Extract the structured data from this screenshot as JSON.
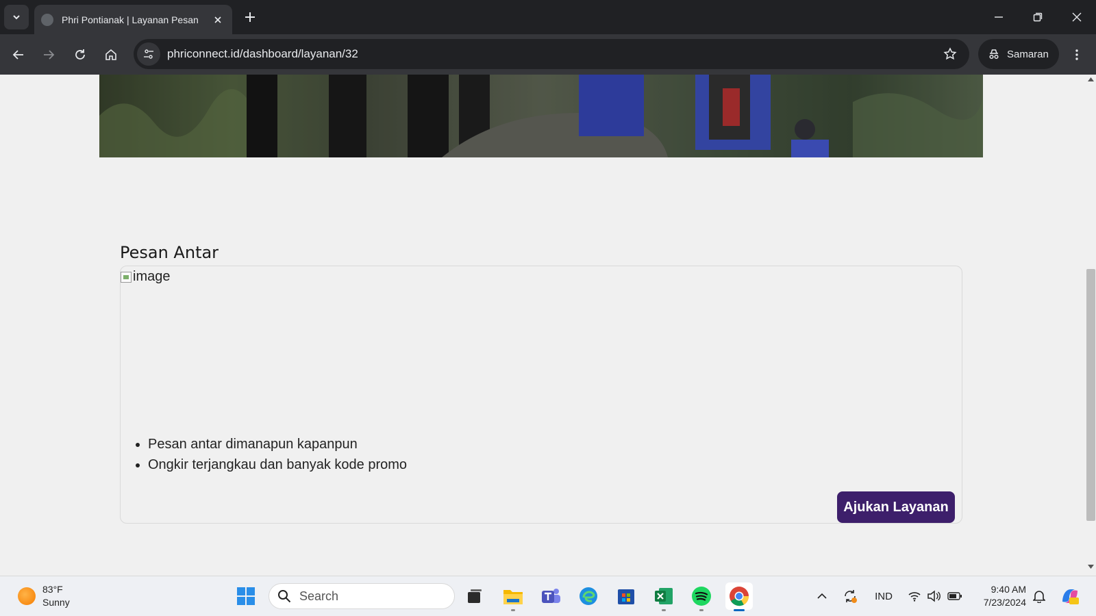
{
  "browser": {
    "tab_title": "Phri Pontianak | Layanan Pesan",
    "url": "phriconnect.id/dashboard/layanan/32",
    "profile_label": "Samaran"
  },
  "page": {
    "section_title": "Pesan Antar",
    "image_alt": "image",
    "features": [
      "Pesan antar dimanapun kapanpun",
      "Ongkir terjangkau dan banyak kode promo"
    ],
    "submit_label": "Ajukan Layanan",
    "accent_color": "#3d1f6b"
  },
  "taskbar": {
    "weather_temp": "83°F",
    "weather_desc": "Sunny",
    "search_placeholder": "Search",
    "language": "IND",
    "time": "9:40 AM",
    "date": "7/23/2024",
    "pinned_apps": [
      "start-icon",
      "task-view-icon",
      "file-explorer-icon",
      "teams-icon",
      "edge-icon",
      "store-icon",
      "excel-icon",
      "spotify-icon",
      "chrome-icon"
    ]
  }
}
